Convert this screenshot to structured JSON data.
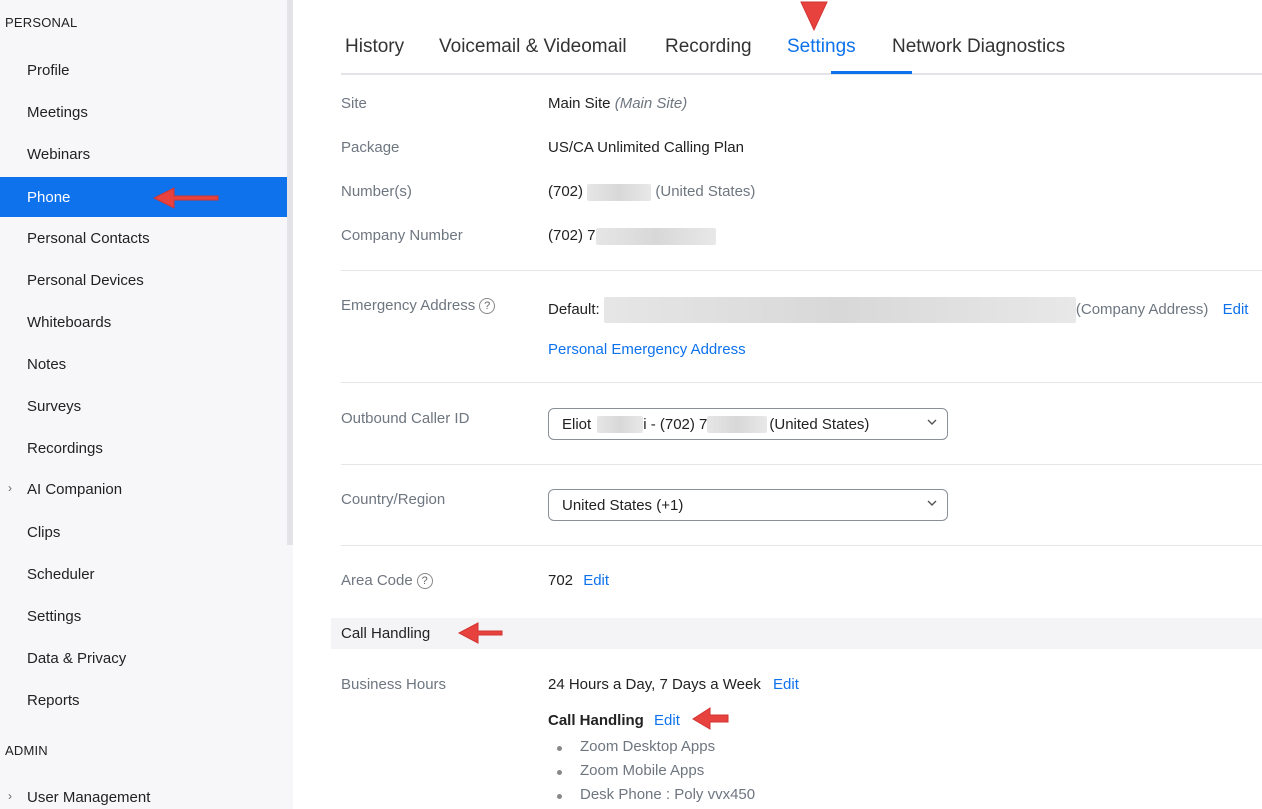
{
  "sidebar": {
    "personal_title": "PERSONAL",
    "admin_title": "ADMIN",
    "items": [
      {
        "label": "Profile"
      },
      {
        "label": "Meetings"
      },
      {
        "label": "Webinars"
      },
      {
        "label": "Phone"
      },
      {
        "label": "Personal Contacts"
      },
      {
        "label": "Personal Devices"
      },
      {
        "label": "Whiteboards"
      },
      {
        "label": "Notes"
      },
      {
        "label": "Surveys"
      },
      {
        "label": "Recordings"
      },
      {
        "label": "AI Companion"
      },
      {
        "label": "Clips"
      },
      {
        "label": "Scheduler"
      },
      {
        "label": "Settings"
      },
      {
        "label": "Data & Privacy"
      },
      {
        "label": "Reports"
      }
    ],
    "admin_items": [
      {
        "label": "User Management"
      }
    ],
    "active": "Phone"
  },
  "tabs": [
    {
      "label": "History"
    },
    {
      "label": "Voicemail & Videomail"
    },
    {
      "label": "Recording"
    },
    {
      "label": "Settings"
    },
    {
      "label": "Network Diagnostics"
    }
  ],
  "active_tab": "Settings",
  "settings": {
    "site": {
      "label": "Site",
      "value": "Main Site",
      "note": "(Main Site)"
    },
    "package": {
      "label": "Package",
      "value": "US/CA Unlimited Calling Plan"
    },
    "numbers": {
      "label": "Number(s)",
      "prefix": "(702)",
      "suffix": "(United States)"
    },
    "company_number": {
      "label": "Company Number",
      "prefix": "(702) 7"
    },
    "emergency": {
      "label": "Emergency Address",
      "help": "?",
      "default_label": "Default:",
      "suffix": "(Company Address)",
      "edit": "Edit",
      "personal_link": "Personal Emergency Address"
    },
    "outbound_caller_id": {
      "label": "Outbound Caller ID",
      "value_start": "Eliot",
      "value_mid": "i - (702) 7",
      "value_end": "(United States)"
    },
    "country_region": {
      "label": "Country/Region",
      "value": "United States (+1)"
    },
    "area_code": {
      "label": "Area Code",
      "help": "?",
      "value": "702",
      "edit": "Edit"
    }
  },
  "call_handling_section": {
    "title": "Call Handling",
    "business_hours": {
      "label": "Business Hours",
      "value": "24 Hours a Day, 7 Days a Week",
      "edit": "Edit"
    },
    "sub_title": "Call Handling",
    "sub_edit": "Edit",
    "devices": [
      "Zoom Desktop Apps",
      "Zoom Mobile Apps",
      "Desk Phone : Poly vvx450"
    ]
  },
  "colors": {
    "accent": "#0e72ed",
    "arrow": "#e8423f",
    "sidebar_bg": "#f7f7fa"
  }
}
